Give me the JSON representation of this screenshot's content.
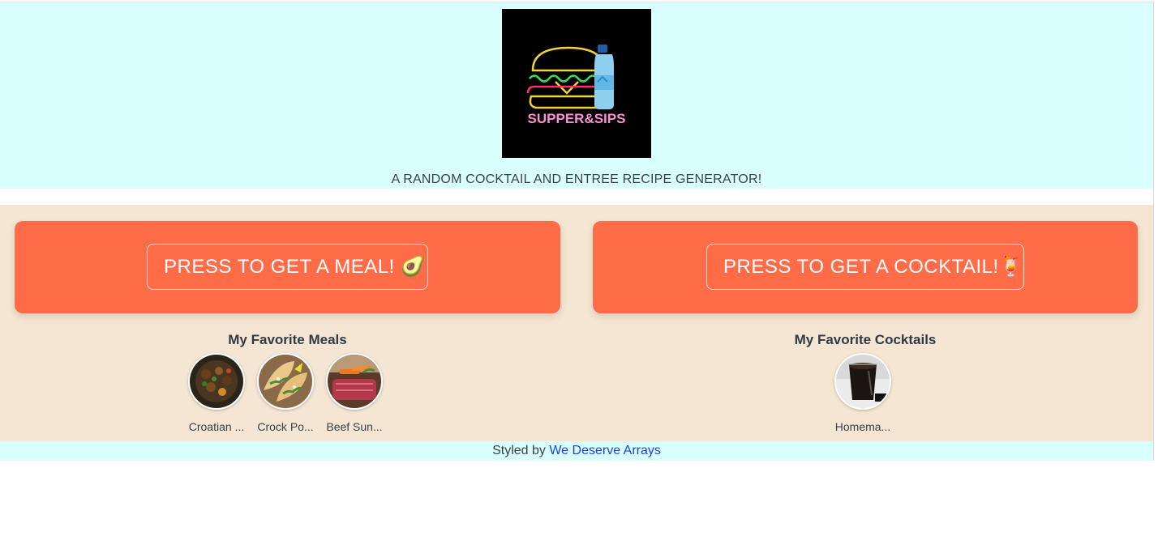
{
  "header": {
    "logo_text": "SUPPER&SIPS",
    "tagline": "A RANDOM COCKTAIL AND ENTREE RECIPE GENERATOR!"
  },
  "meal_card": {
    "button_label": "PRESS TO GET A MEAL! 🥑",
    "color": "#ff6c47"
  },
  "cocktail_card": {
    "button_label": "PRESS TO GET A COCKTAIL!🍹",
    "color": "#ff6c47"
  },
  "favorites": {
    "meals_title": "My Favorite Meals",
    "meals": [
      {
        "label": "Croatian ...",
        "image": "meat-skillet"
      },
      {
        "label": "Crock Po...",
        "image": "tacos"
      },
      {
        "label": "Beef Sun...",
        "image": "roast-beef"
      }
    ],
    "cocktails_title": "My Favorite Cocktails",
    "cocktails": [
      {
        "label": "Homema...",
        "image": "dark-drink-glass"
      }
    ]
  },
  "footer": {
    "prefix": "Styled by ",
    "link_text": "We Deserve Arrays",
    "link_color": "#1d3fe0"
  },
  "colors": {
    "header_bg": "#d9ffff",
    "main_bg": "#f5e6d3",
    "accent": "#ff6c47"
  }
}
